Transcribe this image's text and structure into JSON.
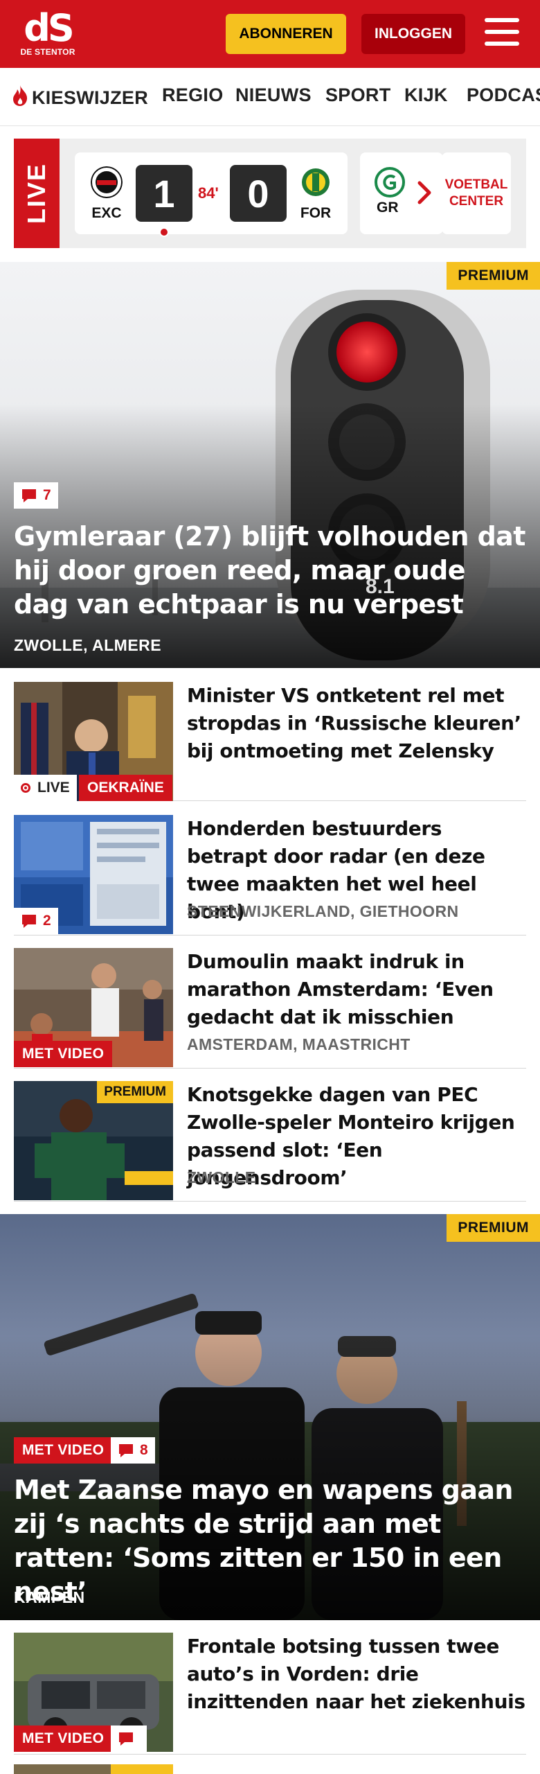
{
  "header": {
    "logo_mark": "dS",
    "logo_sub": "DE STENTOR",
    "subscribe_label": "ABONNEREN",
    "login_label": "INLOGGEN"
  },
  "nav": {
    "items": [
      "KIESWIJZER",
      "REGIO",
      "NIEUWS",
      "SPORT",
      "KIJK",
      "PODCAST"
    ]
  },
  "live": {
    "label": "LIVE",
    "match": {
      "home_team": "EXC",
      "away_team": "FOR",
      "home_score": "1",
      "away_score": "0",
      "minute": "84'"
    },
    "next_match_team": "GR",
    "center_label_1": "VOETBAL",
    "center_label_2": "CENTER"
  },
  "hero1": {
    "premium": "PREMIUM",
    "comments": "7",
    "title": "Gymleraar (27) blijft volhouden dat hij door groen reed, maar oude dag van echtpaar is nu verpest",
    "location": "ZWOLLE, ALMERE",
    "overlay_text": "8.1"
  },
  "articles": [
    {
      "title": "Minister VS ontketent rel met stropdas in ‘Russische kleuren’ bij ontmoeting met Zelensky",
      "live_label": "LIVE",
      "topic": "OEKRAÏNE"
    },
    {
      "title": "Honderden bestuurders betrapt door radar (en deze twee maakten het wel heel bont)",
      "location": "STEENWIJKERLAND, GIETHOORN",
      "comments": "2"
    },
    {
      "title": "Dumoulin maakt indruk in marathon Amsterdam: ‘Even gedacht dat ik misschien moest…",
      "location": "AMSTERDAM, MAASTRICHT",
      "video": "MET VIDEO"
    },
    {
      "title": "Knotsgekke dagen van PEC Zwolle-speler Monteiro krijgen passend slot: ‘Een jongensdroom’",
      "location": "ZWOLLE",
      "premium": "PREMIUM"
    }
  ],
  "hero2": {
    "premium": "PREMIUM",
    "video": "MET VIDEO",
    "comments": "8",
    "title": "Met Zaanse mayo en wapens gaan zij ‘s nachts de strijd aan met ratten: ‘Soms zitten er 150 in een nest’",
    "location": "KAMPEN"
  },
  "article_bottom": {
    "title": "Frontale botsing tussen twee auto’s in Vorden: drie inzittenden naar het ziekenhuis",
    "video": "MET VIDEO"
  },
  "colors": {
    "brand_red": "#d0141c",
    "premium_yellow": "#f5c11f"
  }
}
